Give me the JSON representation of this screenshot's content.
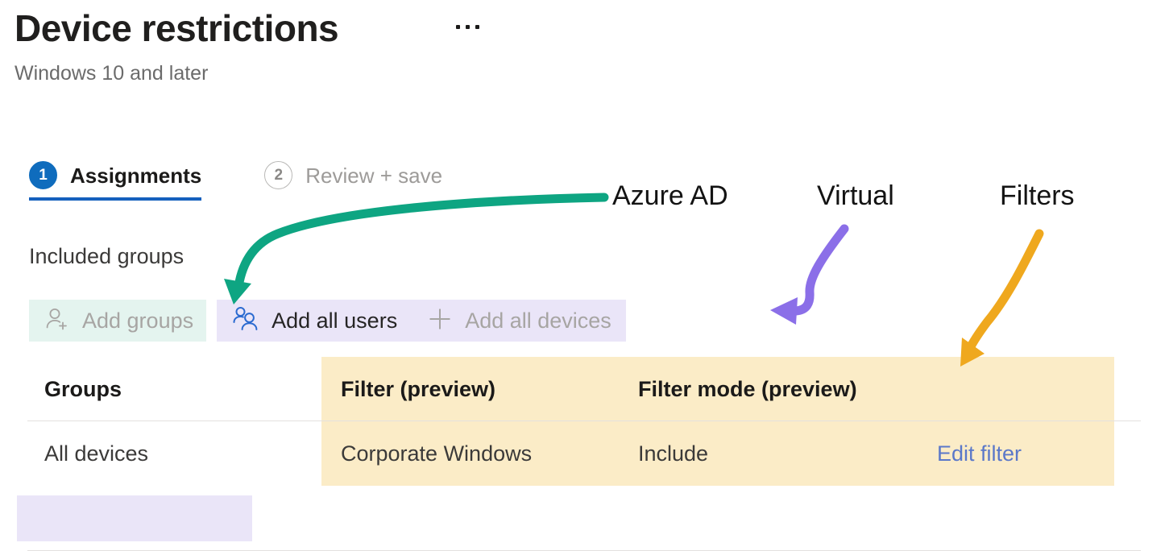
{
  "header": {
    "title": "Device restrictions",
    "subtitle": "Windows 10 and later",
    "more_menu_label": "More options"
  },
  "wizard": {
    "tabs": [
      {
        "number": "1",
        "label": "Assignments",
        "state": "active"
      },
      {
        "number": "2",
        "label": "Review + save",
        "state": "inactive"
      }
    ]
  },
  "section": {
    "included_groups_label": "Included groups"
  },
  "commandbar": {
    "buttons": [
      {
        "label": "Add groups",
        "icon": "add-user-icon",
        "state": "disabled",
        "highlight": "#e4f4ef"
      },
      {
        "label": "Add all users",
        "icon": "people-icon",
        "state": "enabled",
        "highlight": "#eae5f8"
      },
      {
        "label": "Add all devices",
        "icon": "plus-icon",
        "state": "disabled",
        "highlight": "#eae5f8"
      }
    ]
  },
  "table": {
    "columns": [
      "Groups",
      "Filter (preview)",
      "Filter mode (preview)",
      ""
    ],
    "rows": [
      {
        "group": "All devices",
        "filter": "Corporate Windows",
        "filter_mode": "Include",
        "action": "Edit filter"
      }
    ]
  },
  "annotations": {
    "labels": [
      {
        "text": "Azure AD",
        "color": "#0ea582"
      },
      {
        "text": "Virtual",
        "color": "#8b6fe8"
      },
      {
        "text": "Filters",
        "color": "#efa81e"
      }
    ],
    "arrows": [
      {
        "name": "green-arrow-to-add-groups",
        "color": "#0ea582"
      },
      {
        "name": "purple-arrow-to-command-bar",
        "color": "#8b6fe8"
      },
      {
        "name": "orange-arrow-to-filter-columns",
        "color": "#efa81e"
      }
    ]
  },
  "colors": {
    "accent_blue": "#0f6cbd",
    "link_blue": "#5b78c9",
    "highlight_mint": "#e4f4ef",
    "highlight_lavender": "#eae5f8",
    "highlight_cream": "#fbecc7",
    "annotation_green": "#0ea582",
    "annotation_purple": "#8b6fe8",
    "annotation_orange": "#efa81e"
  }
}
